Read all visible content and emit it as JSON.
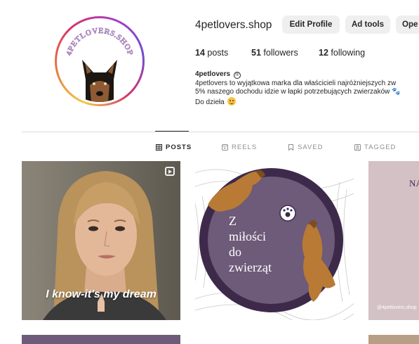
{
  "profile": {
    "username": "4petlovers.shop",
    "buttons": {
      "edit": "Edit Profile",
      "ad_tools": "Ad tools",
      "open": "Ope"
    },
    "avatar": {
      "label": "4PETLOVERS.SHOP",
      "ring_colors": [
        "#f2c94c",
        "#e8793b",
        "#d6336c",
        "#a83fc1"
      ]
    },
    "stats": {
      "posts_count": "14",
      "posts_label": "posts",
      "followers_count": "51",
      "followers_label": "followers",
      "following_count": "12",
      "following_label": "following"
    },
    "bio": {
      "name": "4petlovers",
      "verified_symbol": "®",
      "line1": "4petlovers to wyjątkowa marka dla właścicieli najróżniejszych zw",
      "line2": "5% naszego dochodu idzie w łapki potrzebujących zwierzaków 🐾",
      "line3": "Do dzieła",
      "emoji_icon": "smiling-face-emoji-icon"
    }
  },
  "tabs": [
    {
      "label": "POSTS",
      "icon": "grid-icon",
      "active": true
    },
    {
      "label": "REELS",
      "icon": "reels-icon",
      "active": false
    },
    {
      "label": "SAVED",
      "icon": "bookmark-icon",
      "active": false
    },
    {
      "label": "TAGGED",
      "icon": "tag-person-icon",
      "active": false
    }
  ],
  "posts": [
    {
      "caption": "I know-it's my dream",
      "type": "reel",
      "icon": "reel-icon"
    },
    {
      "lines": [
        "Z",
        "miłości",
        "do",
        "zwierząt"
      ],
      "accent": "#6e5a79"
    },
    {
      "partial_title": "NA",
      "handle": "@4petlovers.shop"
    }
  ],
  "colors": {
    "accent_purple": "#6e5a79",
    "dark_purple": "#3d2a4a",
    "button_bg": "#efefef"
  }
}
